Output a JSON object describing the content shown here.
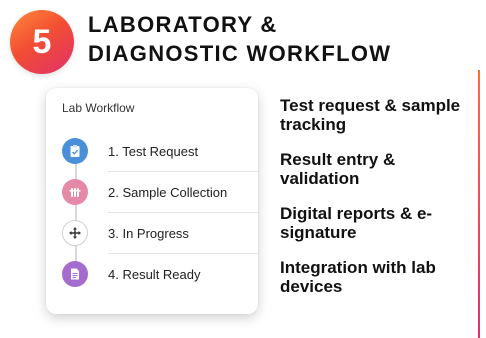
{
  "badge": {
    "number": "5"
  },
  "header": {
    "title_line1": "LABORATORY &",
    "title_line2": "DIAGNOSTIC WORKFLOW"
  },
  "card": {
    "title": "Lab Workflow",
    "steps": [
      {
        "label": "1. Test Request",
        "icon": "clipboard-icon",
        "color": "#4a90d9"
      },
      {
        "label": "2. Sample Collection",
        "icon": "test-tubes-icon",
        "color": "#e58aa6"
      },
      {
        "label": "3. In Progress",
        "icon": "move-arrows-icon",
        "color": "#ffffff"
      },
      {
        "label": "4. Result Ready",
        "icon": "document-icon",
        "color": "#a56ccf"
      }
    ]
  },
  "features": [
    "Test request & sample tracking",
    "Result entry & validation",
    "Digital reports & e-signature",
    "Integration with lab devices"
  ],
  "colors": {
    "accent_start": "#ff8a3d",
    "accent_end": "#e1306c"
  }
}
